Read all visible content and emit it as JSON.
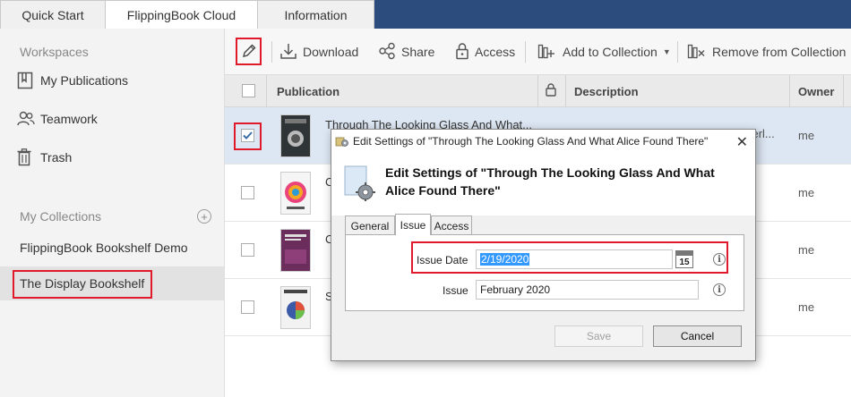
{
  "top_tabs": [
    {
      "label": "Quick Start"
    },
    {
      "label": "FlippingBook Cloud"
    },
    {
      "label": "Information"
    }
  ],
  "sidebar": {
    "workspaces_heading": "Workspaces",
    "items": [
      {
        "label": "My Publications",
        "icon": "bookmark-book-icon"
      },
      {
        "label": "Teamwork",
        "icon": "users-icon"
      },
      {
        "label": "Trash",
        "icon": "trash-icon"
      }
    ],
    "collections_heading": "My Collections",
    "collections": [
      {
        "label": "FlippingBook Bookshelf Demo"
      },
      {
        "label": "The Display Bookshelf"
      }
    ]
  },
  "toolbar": {
    "edit_icon": "pencil-icon",
    "download": "Download",
    "share": "Share",
    "access": "Access",
    "add_to_collection": "Add to Collection",
    "remove_from_collection": "Remove from Collection"
  },
  "table": {
    "headers": {
      "publication": "Publication",
      "description": "Description",
      "owner": "Owner"
    },
    "rows": [
      {
        "title": "Through The Looking Glass And What...",
        "description": "nderl...",
        "owner": "me",
        "checked": true
      },
      {
        "title": "C",
        "description": "",
        "owner": "me",
        "checked": false
      },
      {
        "title": "C",
        "description": "",
        "owner": "me",
        "checked": false
      },
      {
        "title": "S",
        "description": "",
        "owner": "me",
        "checked": false
      }
    ]
  },
  "dialog": {
    "title": "Edit Settings of \"Through The Looking Glass And What Alice Found There\"",
    "heading": "Edit Settings of \"Through The Looking Glass And What Alice Found There\"",
    "tabs": [
      {
        "label": "General"
      },
      {
        "label": "Issue"
      },
      {
        "label": "Access"
      }
    ],
    "issue_date_label": "Issue Date",
    "issue_date_value": "2/19/2020",
    "calendar_day": "15",
    "issue_label": "Issue",
    "issue_value": "February 2020",
    "save_label": "Save",
    "cancel_label": "Cancel",
    "close_symbol": "✕"
  }
}
